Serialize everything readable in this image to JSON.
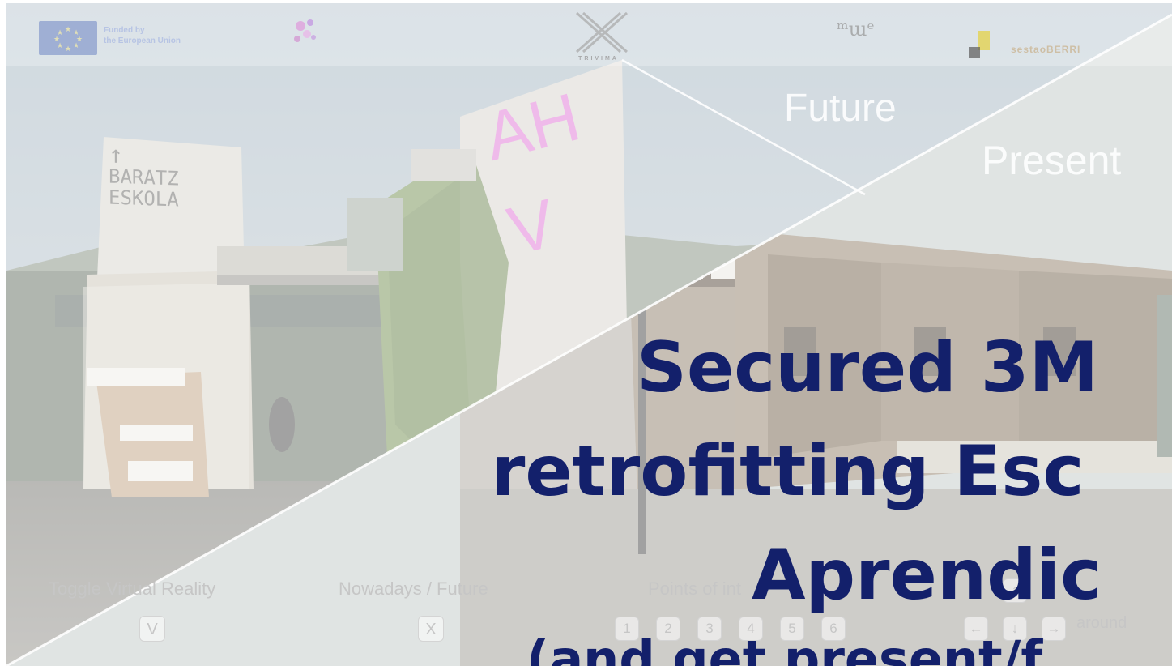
{
  "logos": {
    "eu_line1": "Funded by",
    "eu_line2": "the European Union",
    "trivima": "TRIVIMA",
    "mue": "ᵐɯᵉ",
    "sestao": "sestaoBERRI"
  },
  "scene": {
    "sign_line1": "BARATZ",
    "sign_line2": "ESKOLA",
    "graffiti": "AH V",
    "future_label": "Future",
    "present_label": "Present"
  },
  "controls": {
    "vr_label": "Toggle Virtual Reality",
    "vr_key": "V",
    "toggle_label": "Nowadays / Future",
    "toggle_key": "X",
    "poi_label": "Points of int",
    "poi_keys": [
      "1",
      "2",
      "3",
      "4",
      "5",
      "6"
    ],
    "move_label": "around",
    "arrow_up": "↑",
    "arrow_left": "←",
    "arrow_down": "↓",
    "arrow_right": "→"
  },
  "headline": {
    "line1": "Secured 3M",
    "line2": "retrofitting Esc",
    "line3": "Aprendic",
    "line4": "(and get present/f"
  },
  "colors": {
    "headline": "#13206b",
    "eu_blue": "#6e86c4",
    "veil": "#ffffff"
  }
}
